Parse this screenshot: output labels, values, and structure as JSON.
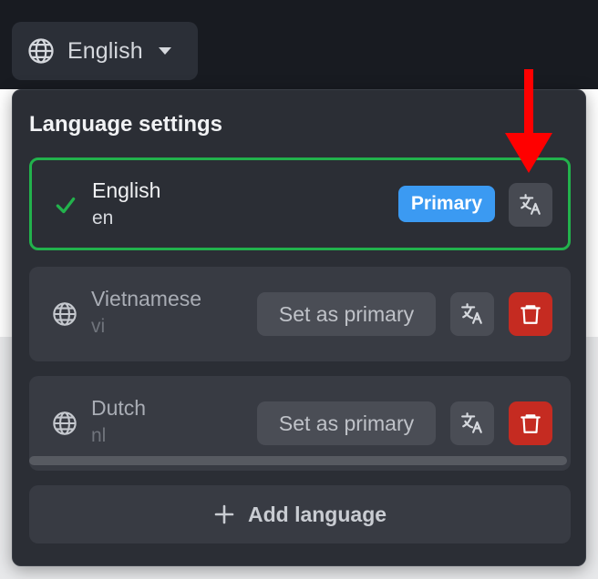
{
  "language_button": {
    "label": "English",
    "icon": "globe-icon",
    "caret_icon": "caret-down-icon"
  },
  "panel": {
    "title": "Language settings",
    "languages": [
      {
        "name": "English",
        "code": "en",
        "is_primary": true,
        "badge": "Primary",
        "status_icon": "check-icon"
      },
      {
        "name": "Vietnamese",
        "code": "vi",
        "is_primary": false,
        "action_label": "Set as primary",
        "status_icon": "globe-icon"
      },
      {
        "name": "Dutch",
        "code": "nl",
        "is_primary": false,
        "action_label": "Set as primary",
        "status_icon": "globe-icon"
      }
    ],
    "add_language_label": "Add language"
  },
  "colors": {
    "primary_border": "#22b24c",
    "primary_badge": "#3b9af2",
    "delete_button": "#c52b21",
    "annotation_arrow": "#ff0000"
  }
}
